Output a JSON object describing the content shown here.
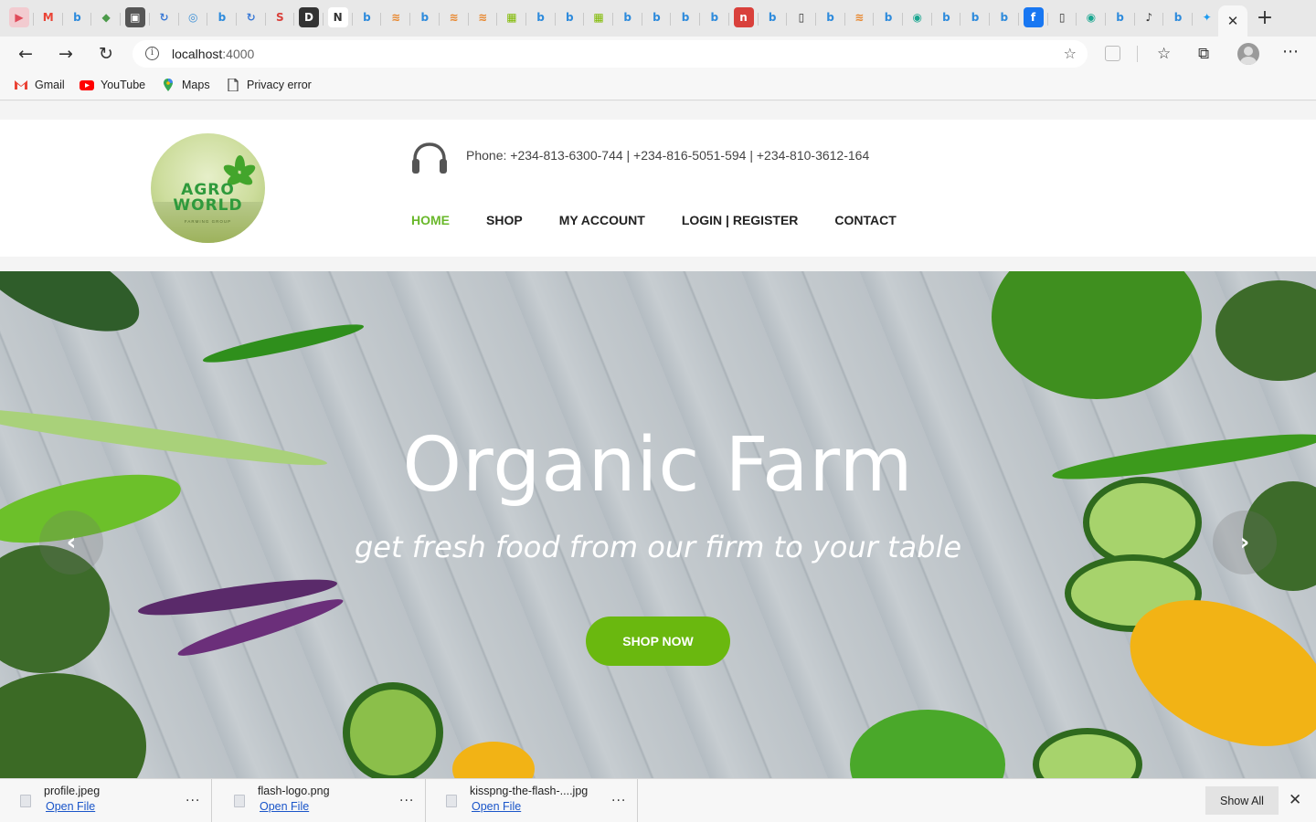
{
  "browser": {
    "tab_icons": [
      "youtube-icon",
      "gmail-icon",
      "bing-icon",
      "maps-icon",
      "media-icon",
      "sync-icon",
      "radio-icon",
      "bing-icon",
      "sync-icon",
      "s-icon",
      "dev-icon",
      "notion-icon",
      "bing-icon",
      "stack-icon",
      "bing-icon",
      "stack-icon",
      "stack-icon",
      "microsoft-icon",
      "bing-icon",
      "bing-icon",
      "microsoft-icon",
      "bing-icon",
      "bing-icon",
      "bing-icon",
      "bing-icon",
      "n-icon",
      "bing-icon",
      "document-icon",
      "bing-icon",
      "stack-icon",
      "bing-icon",
      "eye-icon",
      "bing-icon",
      "bing-icon",
      "bing-icon",
      "facebook-icon",
      "document-icon",
      "eye-icon",
      "bing-icon",
      "speaker-icon",
      "bing-icon",
      "twitter-icon"
    ],
    "active_tab_close": "✕",
    "new_tab": "+",
    "url_host": "localhost",
    "url_port": ":4000"
  },
  "bookmarks": [
    {
      "label": "Gmail",
      "icon": "gmail-icon"
    },
    {
      "label": "YouTube",
      "icon": "youtube-icon"
    },
    {
      "label": "Maps",
      "icon": "maps-icon"
    },
    {
      "label": "Privacy error",
      "icon": "document-icon"
    }
  ],
  "site": {
    "logo_line1": "AGRO",
    "logo_line2": "WORLD",
    "logo_tagline": "FARMING GROUP",
    "phone": "Phone: +234-813-6300-744 | +234-816-5051-594 | +234-810-3612-164",
    "nav": [
      {
        "label": "HOME",
        "active": true
      },
      {
        "label": "SHOP",
        "active": false
      },
      {
        "label": "MY ACCOUNT",
        "active": false
      },
      {
        "label": "LOGIN | REGISTER",
        "active": false
      },
      {
        "label": "CONTACT",
        "active": false
      }
    ],
    "accent_color": "#6ab80f",
    "hero": {
      "title": "Organic Farm",
      "subtitle": "get fresh food from our firm to your table",
      "cta": "SHOP NOW",
      "prev": "‹",
      "next": "›"
    }
  },
  "downloads": {
    "items": [
      {
        "name": "profile.jpeg",
        "action": "Open File"
      },
      {
        "name": "flash-logo.png",
        "action": "Open File"
      },
      {
        "name": "kisspng-the-flash-....jpg",
        "action": "Open File"
      }
    ],
    "more": "...",
    "show_all": "Show All",
    "close": "✕"
  }
}
